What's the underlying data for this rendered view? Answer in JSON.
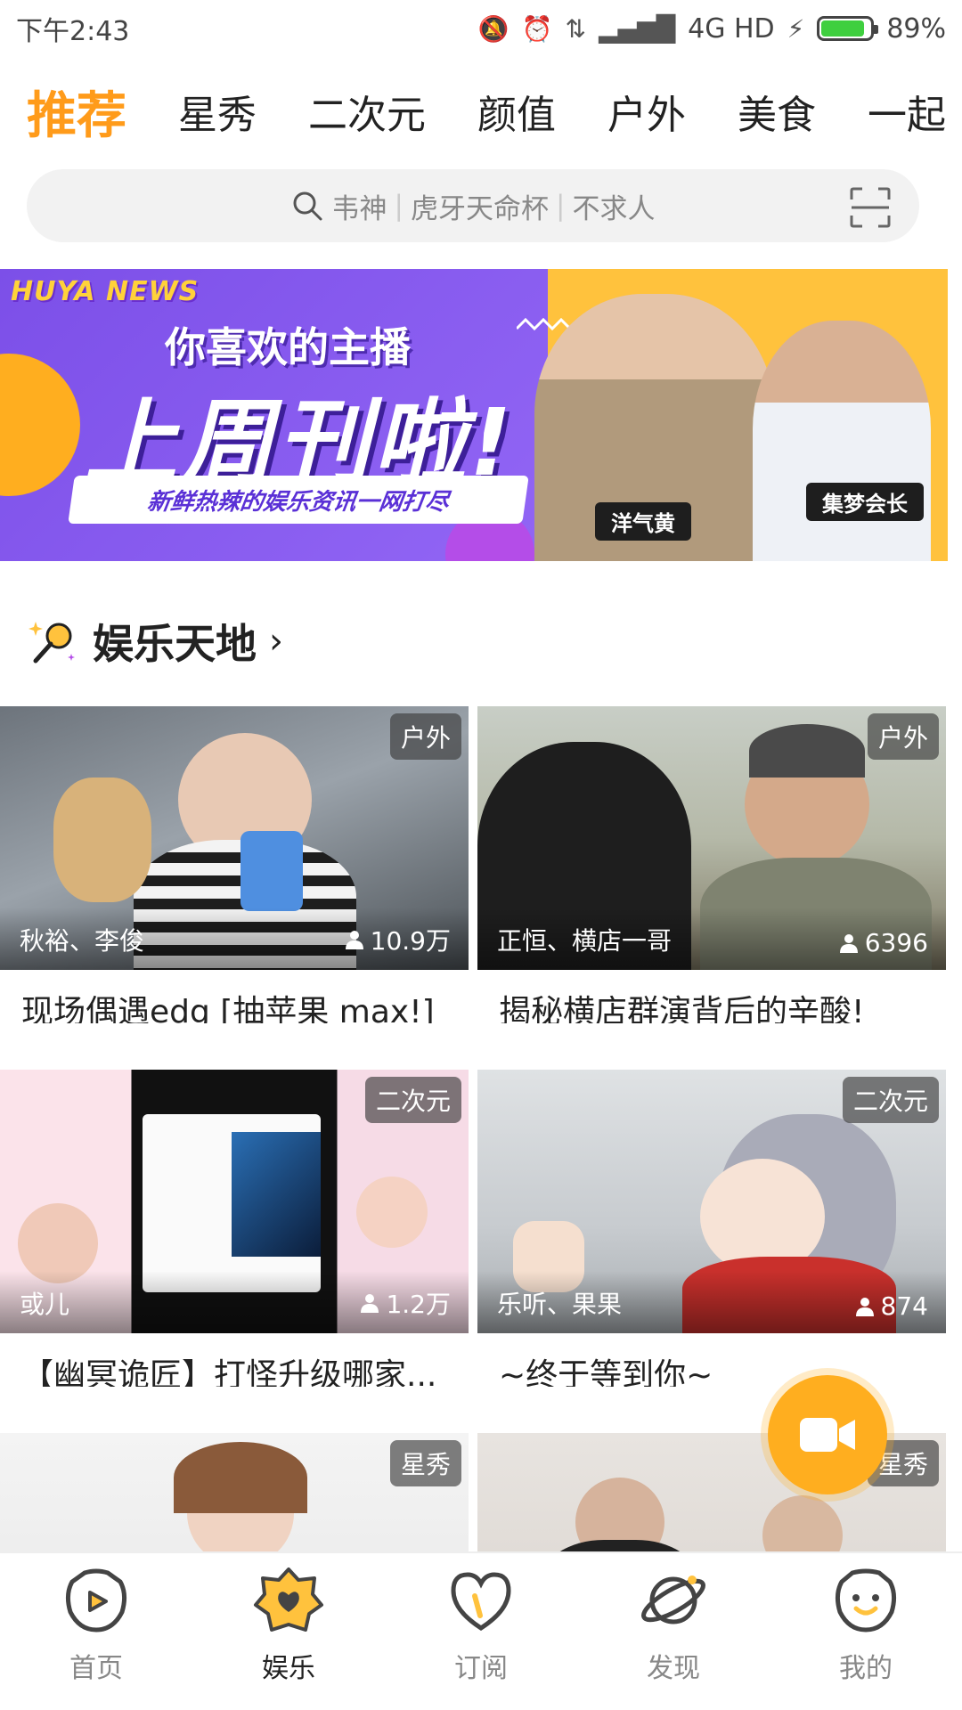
{
  "status_bar": {
    "time": "下午2:43",
    "network": "4G HD",
    "battery": "89%",
    "battery_level": 0.89
  },
  "tabs": [
    {
      "label": "推荐",
      "active": true
    },
    {
      "label": "星秀"
    },
    {
      "label": "二次元"
    },
    {
      "label": "颜值"
    },
    {
      "label": "户外"
    },
    {
      "label": "美食"
    },
    {
      "label": "一起"
    }
  ],
  "search": {
    "hints": [
      "韦神",
      "虎牙天命杯",
      "不求人"
    ],
    "icon": "search-icon",
    "scan_icon": "scan-icon"
  },
  "banner": {
    "logo": "HUYA NEWS",
    "subtitle": "你喜欢的主播",
    "headline": "上周刊啦!",
    "tagline": "新鲜热辣的娱乐资讯一网打尽",
    "people": [
      "洋气黄",
      "集梦会长"
    ]
  },
  "section": {
    "title": "娱乐天地",
    "icon": "microphone-sparkle-icon"
  },
  "cards": [
    {
      "badge": "户外",
      "hosts": "秋裕、李俊",
      "viewers": "10.9万",
      "title": "现场偶遇edg [抽苹果 max!]"
    },
    {
      "badge": "户外",
      "hosts": "正恒、横店一哥",
      "viewers": "6396",
      "title": "揭秘横店群演背后的辛酸!"
    },
    {
      "badge": "二次元",
      "hosts": "或儿",
      "viewers": "1.2万",
      "title": "【幽冥诡匠】打怪升级哪家..."
    },
    {
      "badge": "二次元",
      "hosts": "乐听、果果",
      "viewers": "874",
      "title": "~终于等到你~"
    },
    {
      "badge": "星秀",
      "hosts": "",
      "viewers": "",
      "title": ""
    },
    {
      "badge": "星秀",
      "hosts": "",
      "viewers": "",
      "title": ""
    }
  ],
  "fab": {
    "icon": "video-camera-icon"
  },
  "bottom_nav": [
    {
      "label": "首页",
      "icon": "home-play-icon"
    },
    {
      "label": "娱乐",
      "icon": "entertainment-heart-icon",
      "active": true
    },
    {
      "label": "订阅",
      "icon": "subscribe-heart-icon"
    },
    {
      "label": "发现",
      "icon": "planet-icon"
    },
    {
      "label": "我的",
      "icon": "profile-face-icon"
    }
  ],
  "colors": {
    "accent": "#ff9b1a",
    "banner_purple": "#7c4fe8",
    "banner_yellow": "#ffc23d",
    "fab": "#ffae1f"
  }
}
